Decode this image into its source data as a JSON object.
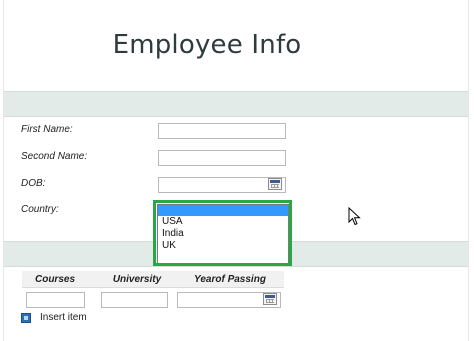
{
  "title": "Employee Info",
  "fields": {
    "first_name": {
      "label": "First Name:",
      "value": ""
    },
    "second_name": {
      "label": "Second Name:",
      "value": ""
    },
    "dob": {
      "label": "DOB:",
      "value": ""
    },
    "country": {
      "label": "Country:"
    }
  },
  "country_dropdown": {
    "options": [
      "",
      "USA",
      "India",
      "UK"
    ],
    "selected_index": 0
  },
  "table": {
    "columns": [
      "Courses",
      "University",
      "Yearof Passing"
    ],
    "insert_label": "Insert item"
  },
  "colors": {
    "band": "#e3ebe8",
    "highlight": "#27a844",
    "selection": "#3399ff"
  },
  "icons": {
    "date_picker": "calendar-icon",
    "insert": "insert-item-icon",
    "pointer": "mouse-cursor-icon"
  }
}
